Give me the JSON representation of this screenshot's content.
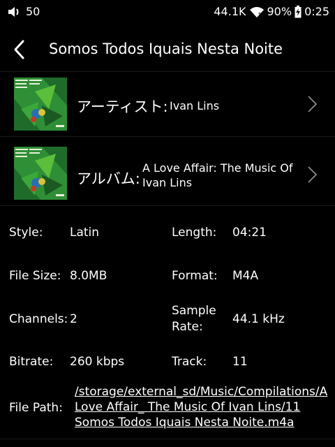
{
  "status": {
    "volume": "50",
    "sample_rate": "44.1K",
    "battery": "90%",
    "time": "0:25"
  },
  "header": {
    "title": "Somos Todos Iquais Nesta Noite"
  },
  "artist_row": {
    "label": "アーティスト:",
    "value": "Ivan Lins"
  },
  "album_row": {
    "label": "アルバム:",
    "value": "A Love Affair: The Music Of Ivan Lins"
  },
  "details": {
    "style_label": "Style:",
    "style_value": "Latin",
    "length_label": "Length:",
    "length_value": "04:21",
    "filesize_label": "File Size:",
    "filesize_value": "8.0MB",
    "format_label": "Format:",
    "format_value": "M4A",
    "channels_label": "Channels:",
    "channels_value": "2",
    "samplerate_label_1": "Sample",
    "samplerate_label_2": "Rate:",
    "samplerate_value": "44.1 kHz",
    "bitrate_label": "Bitrate:",
    "bitrate_value": "260 kbps",
    "track_label": "Track:",
    "track_value": "11",
    "filepath_label": "File Path:",
    "filepath_value": "/storage/external_sd/Music/Compilations/A Love Affair_ The Music Of Ivan Lins/11 Somos Todos Iquais Nesta Noite.m4a"
  },
  "colors": {
    "background": "#000000",
    "text": "#ffffff",
    "chevron": "#8a8a8a"
  }
}
